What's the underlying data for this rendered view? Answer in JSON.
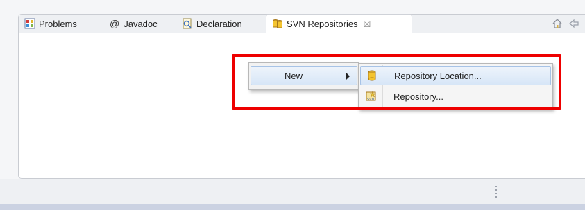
{
  "tabs": [
    {
      "label": "Problems",
      "icon": "problems-icon"
    },
    {
      "label": "Javadoc",
      "icon_glyph": "@",
      "icon": "javadoc-icon"
    },
    {
      "label": "Declaration",
      "icon": "declaration-icon"
    },
    {
      "label": "SVN Repositories",
      "icon": "svn-repositories-icon",
      "active": true,
      "close_glyph": "☒"
    }
  ],
  "context_menu": {
    "new_label": "New"
  },
  "submenu": {
    "items": [
      {
        "label": "Repository Location...",
        "icon": "database-icon",
        "highlighted": true
      },
      {
        "label": "Repository...",
        "icon": "svn-repository-icon"
      }
    ]
  },
  "colors": {
    "highlight_box": "#ee0000",
    "menu_hover": "#d7e6f7"
  }
}
